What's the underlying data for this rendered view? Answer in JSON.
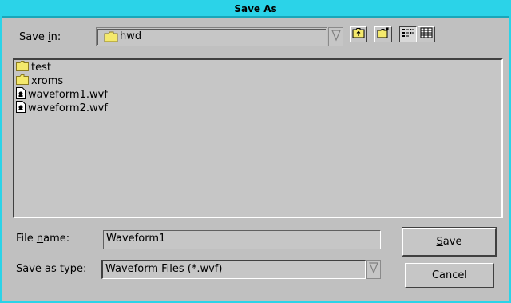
{
  "window": {
    "title": "Save As"
  },
  "save_in": {
    "label_pre": "Save ",
    "label_hot": "i",
    "label_post": "n:",
    "value": "hwd"
  },
  "toolbar": {
    "up_icon": "folder-up-icon",
    "new_folder_icon": "new-folder-icon",
    "list_view_icon": "list-view-icon",
    "details_view_icon": "details-view-icon"
  },
  "files": [
    {
      "name": "test",
      "icon": "folder-icon"
    },
    {
      "name": "xroms",
      "icon": "folder-icon"
    },
    {
      "name": "waveform1.wvf",
      "icon": "file-icon"
    },
    {
      "name": "waveform2.wvf",
      "icon": "file-icon"
    }
  ],
  "file_name": {
    "label_pre": "File ",
    "label_hot": "n",
    "label_post": "ame:",
    "value": "Waveform1"
  },
  "save_type": {
    "label": "Save as type:",
    "value": "Waveform Files (*.wvf)"
  },
  "buttons": {
    "save_hot": "S",
    "save_rest": "ave",
    "cancel": "Cancel"
  },
  "colors": {
    "title_bar": "#2bd3e8",
    "folder": "#f4e96c",
    "face": "#c0c0c0"
  }
}
